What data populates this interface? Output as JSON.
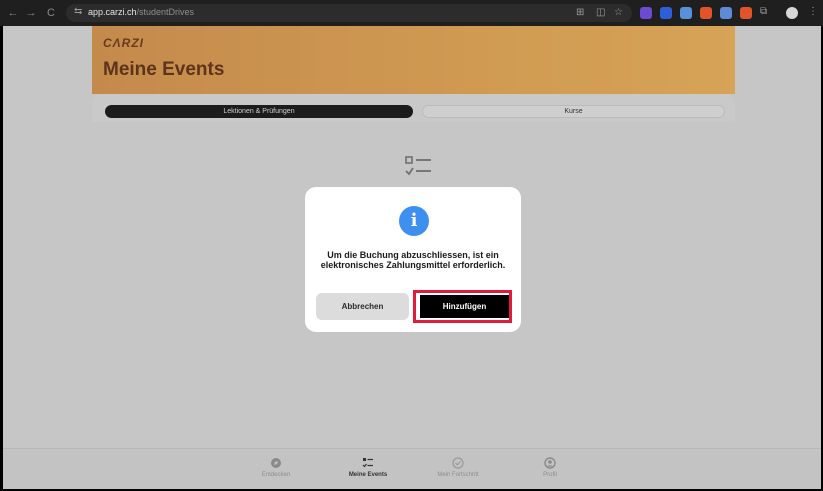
{
  "browser": {
    "url_domain": "app.carzi.ch",
    "url_path": "/studentDrives",
    "back_icon": "←",
    "forward_icon": "→",
    "reload_icon": "C",
    "site_settings_icon": "⇆"
  },
  "header": {
    "logo_text": "CΛRZI",
    "title": "Meine Events"
  },
  "tabs": {
    "active_label": "Lektionen & Prüfungen",
    "inactive_label": "Kurse"
  },
  "modal": {
    "info_glyph": "i",
    "message": "Um die Buchung abzuschliessen, ist ein elektronisches Zahlungsmittel erforderlich.",
    "cancel_label": "Abbrechen",
    "confirm_label": "Hinzufügen"
  },
  "bottom_nav": {
    "items": [
      {
        "label": "Entdecken",
        "icon": "compass-icon"
      },
      {
        "label": "Meine Events",
        "icon": "checklist-icon"
      },
      {
        "label": "Mein Fortschritt",
        "icon": "check-circle-icon"
      },
      {
        "label": "Profil",
        "icon": "user-icon"
      }
    ]
  },
  "colors": {
    "accent_blue": "#3d8ff0",
    "highlight_red": "#e21a3c",
    "brand_orange": "#d09a52"
  }
}
